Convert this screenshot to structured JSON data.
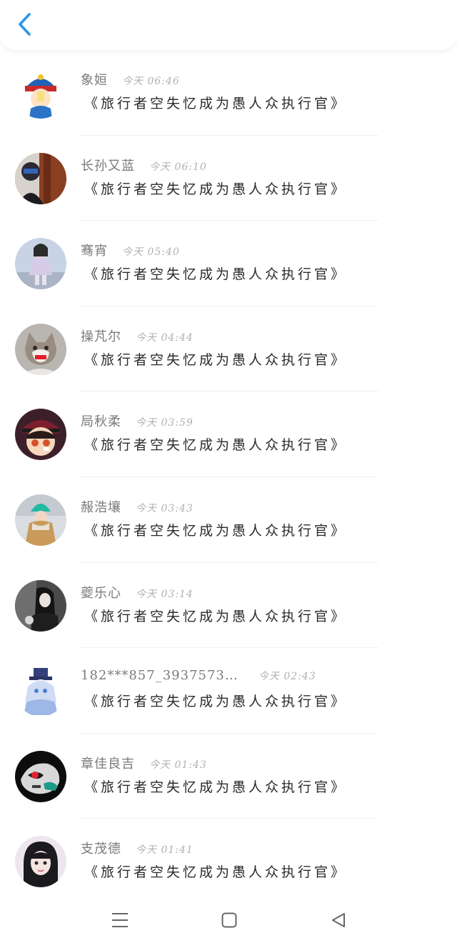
{
  "header": {
    "back_icon": "chevron-left-icon",
    "accent": "#2b95e9"
  },
  "messages": [
    {
      "name": "象姮",
      "time": "今天 06:46",
      "text": "《旅行者空失忆成为愚人众执行官》",
      "avatar": "cartoon-hat-avatar"
    },
    {
      "name": "长孙又蓝",
      "time": "今天 06:10",
      "text": "《旅行者空失忆成为愚人众执行官》",
      "avatar": "selfie-avatar"
    },
    {
      "name": "骞宵",
      "time": "今天 05:40",
      "text": "《旅行者空失忆成为愚人众执行官》",
      "avatar": "girl-street-avatar"
    },
    {
      "name": "操芃尔",
      "time": "今天 04:44",
      "text": "《旅行者空失忆成为愚人众执行官》",
      "avatar": "cat-avatar"
    },
    {
      "name": "局秋柔",
      "time": "今天 03:59",
      "text": "《旅行者空失忆成为愚人众执行官》",
      "avatar": "anime-boy-avatar"
    },
    {
      "name": "赧浩壤",
      "time": "今天 03:43",
      "text": "《旅行者空失忆成为愚人众执行官》",
      "avatar": "green-hat-avatar"
    },
    {
      "name": "夔乐心",
      "time": "今天 03:14",
      "text": "《旅行者空失忆成为愚人众执行官》",
      "avatar": "dark-girl-avatar"
    },
    {
      "name": "182***857_3937573…",
      "time": "今天 02:43",
      "text": "《旅行者空失忆成为愚人众执行官》",
      "avatar": "anime-blue-avatar"
    },
    {
      "name": "章佳良吉",
      "time": "今天 01:43",
      "text": "《旅行者空失忆成为愚人众执行官》",
      "avatar": "robot-mask-avatar"
    },
    {
      "name": "支茂德",
      "time": "今天 01:41",
      "text": "《旅行者空失忆成为愚人众执行官》",
      "avatar": "girl-selfie-avatar"
    }
  ],
  "nav": {
    "menu_icon": "menu-icon",
    "home_icon": "home-square-icon",
    "back_icon": "triangle-back-icon"
  }
}
